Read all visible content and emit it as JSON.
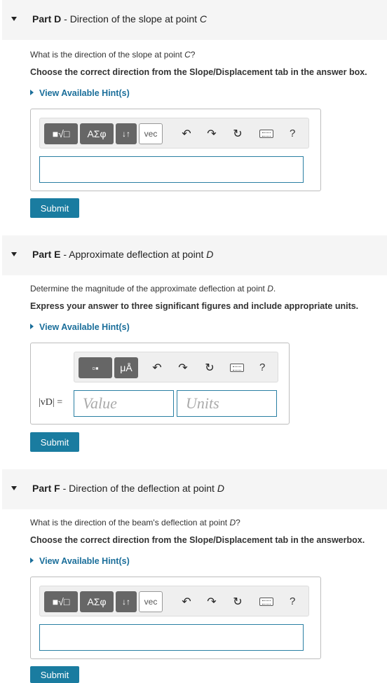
{
  "partD": {
    "part": "Part D",
    "title": "Direction of the slope at point ",
    "title_point": "C",
    "question": "What is the direction of the slope at point ",
    "question_point": "C",
    "question_end": "?",
    "instruction": "Choose the correct direction from the Slope/Displacement tab in the answer box.",
    "hint": "View Available Hint(s)",
    "toolbar": {
      "template_label": "■√□",
      "greek_label": "ΑΣφ",
      "arrows_label": "↓↑",
      "vec_label": "vec",
      "undo": "↶",
      "redo": "↷",
      "reset": "↻",
      "help": "?"
    },
    "submit_label": "Submit"
  },
  "partE": {
    "part": "Part E",
    "title": "Approximate deflection at point ",
    "title_point": "D",
    "question": "Determine the magnitude of the approximate deflection at point ",
    "question_point": "D",
    "question_end": ".",
    "instruction": "Express your answer to three significant figures and include appropriate units.",
    "hint": "View Available Hint(s)",
    "toolbar": {
      "template_label": "▫▪",
      "units_label": "μÅ",
      "undo": "↶",
      "redo": "↷",
      "reset": "↻",
      "help": "?"
    },
    "var_label": "|vD| =",
    "value_placeholder": "Value",
    "units_placeholder": "Units",
    "submit_label": "Submit"
  },
  "partF": {
    "part": "Part F",
    "title": "Direction of the deflection at point ",
    "title_point": "D",
    "question": "What is the direction of the beam's deflection at point ",
    "question_point": "D",
    "question_end": "?",
    "instruction": "Choose the correct direction from the Slope/Displacement tab in the answerbox.",
    "hint": "View Available Hint(s)",
    "toolbar": {
      "template_label": "■√□",
      "greek_label": "ΑΣφ",
      "arrows_label": "↓↑",
      "vec_label": "vec",
      "undo": "↶",
      "redo": "↷",
      "reset": "↻",
      "help": "?"
    },
    "submit_label": "Submit"
  },
  "colors": {
    "accent": "#1a7ca0",
    "hint": "#1a6e9a",
    "input_border": "#2a7fa3",
    "header_bg": "#f5f5f5"
  }
}
